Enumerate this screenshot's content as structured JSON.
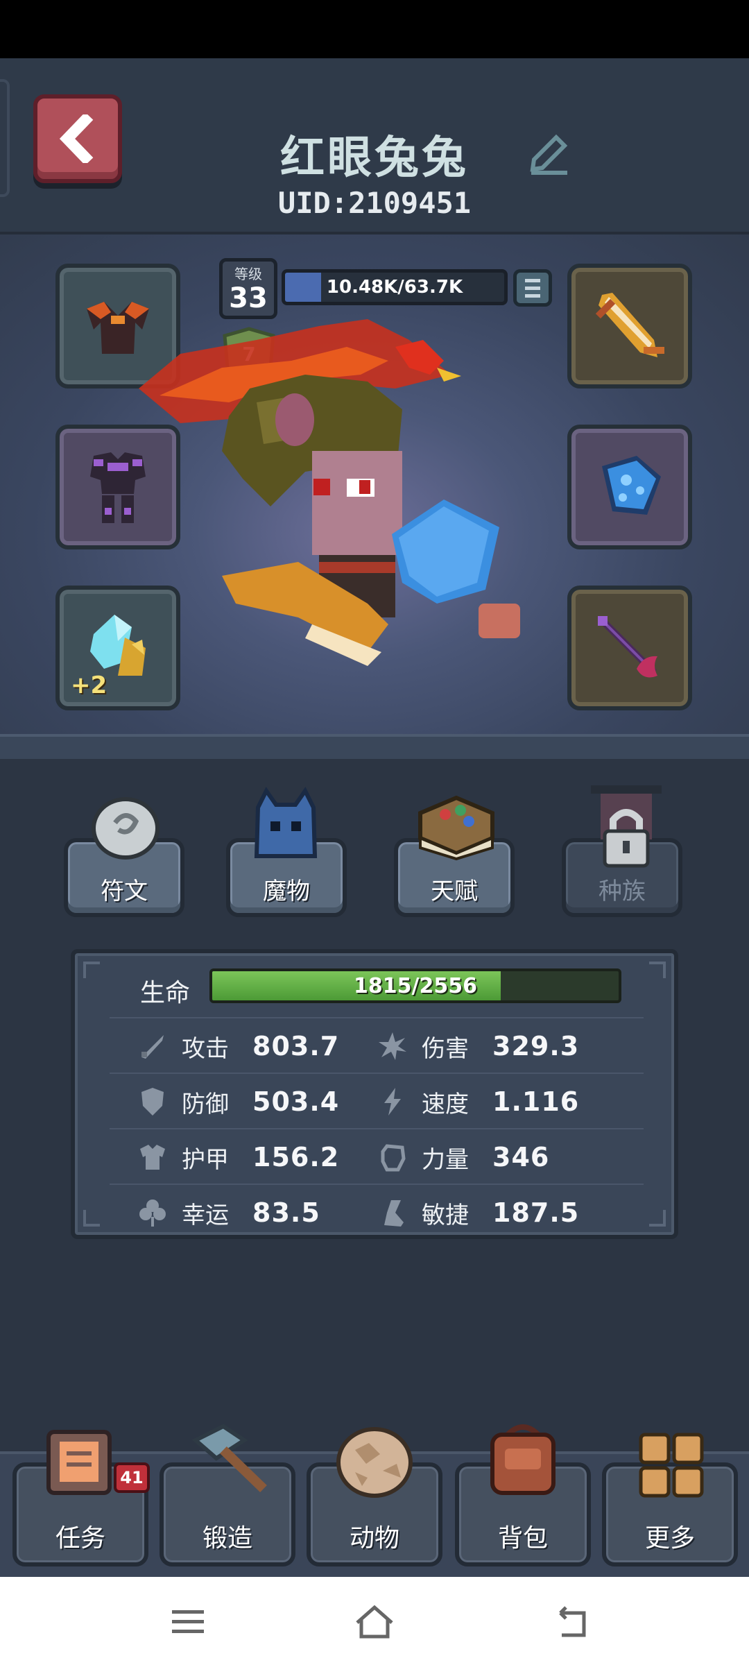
{
  "header": {
    "player_name": "红眼兔兔",
    "uid": "UID:2109451"
  },
  "character": {
    "level_label": "等级",
    "level": "33",
    "xp_text": "10.48K/63.7K",
    "xp_fraction": 0.165,
    "rank_badge": "7",
    "equipment_left": [
      {
        "name": "dark-cape-icon",
        "color": "#c8562a"
      },
      {
        "name": "purple-armor-icon",
        "color": "#7b4ca6"
      },
      {
        "name": "blue-crystal-icon",
        "color": "#6fd3e6",
        "plus": "+2"
      }
    ],
    "equipment_right": [
      {
        "name": "golden-sword-icon",
        "color": "#e0a030"
      },
      {
        "name": "blue-shield-icon",
        "color": "#3b8fe0"
      },
      {
        "name": "dark-scythe-icon",
        "color": "#c03060"
      }
    ]
  },
  "tabs": [
    {
      "label": "符文",
      "icon": "rune-stone-icon"
    },
    {
      "label": "魔物",
      "icon": "monster-icon"
    },
    {
      "label": "天赋",
      "icon": "talent-book-icon"
    },
    {
      "label": "种族",
      "icon": "lock-icon"
    }
  ],
  "stats": {
    "hp_label": "生命",
    "hp_text": "1815/2556",
    "hp_fraction": 0.71,
    "rows": [
      [
        {
          "name": "攻击",
          "value": "803.7",
          "icon": "sword-icon"
        },
        {
          "name": "伤害",
          "value": "329.3",
          "icon": "burst-icon"
        }
      ],
      [
        {
          "name": "防御",
          "value": "503.4",
          "icon": "shield-icon"
        },
        {
          "name": "速度",
          "value": "1.116",
          "icon": "lightning-icon"
        }
      ],
      [
        {
          "name": "护甲",
          "value": "156.2",
          "icon": "armor-icon"
        },
        {
          "name": "力量",
          "value": "346",
          "icon": "fist-icon"
        }
      ],
      [
        {
          "name": "幸运",
          "value": "83.5",
          "icon": "clover-icon"
        },
        {
          "name": "敏捷",
          "value": "187.5",
          "icon": "boot-icon"
        }
      ]
    ]
  },
  "bottom_nav": [
    {
      "label": "任务",
      "icon": "quest-board-icon",
      "badge": "41"
    },
    {
      "label": "锻造",
      "icon": "hammer-icon"
    },
    {
      "label": "动物",
      "icon": "egg-icon"
    },
    {
      "label": "背包",
      "icon": "backpack-icon"
    },
    {
      "label": "更多",
      "icon": "grid-icon"
    }
  ]
}
